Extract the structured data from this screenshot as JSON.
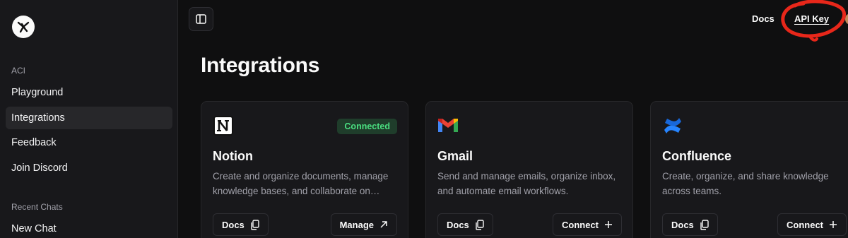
{
  "sidebar": {
    "logo_icon": "aci-logo-icon",
    "section_label": "ACI",
    "items": [
      {
        "label": "Playground",
        "active": false
      },
      {
        "label": "Integrations",
        "active": true
      },
      {
        "label": "Feedback",
        "active": false
      },
      {
        "label": "Join Discord",
        "active": false
      }
    ],
    "recent_label": "Recent Chats",
    "recent_items": [
      {
        "label": "New Chat"
      }
    ]
  },
  "header": {
    "toggle_icon": "sidebar-toggle-icon",
    "docs_label": "Docs",
    "api_key_label": "API Key",
    "annotation_color": "#e8271a"
  },
  "main": {
    "title": "Integrations",
    "cards": [
      {
        "name": "Notion",
        "icon": "notion-icon",
        "badge": "Connected",
        "description": "Create and organize documents, manage knowledge bases, and collaborate on…",
        "docs_label": "Docs",
        "action_label": "Manage",
        "action_icon": "arrow-up-right-icon"
      },
      {
        "name": "Gmail",
        "icon": "gmail-icon",
        "badge": "",
        "description": "Send and manage emails, organize inbox, and automate email workflows.",
        "docs_label": "Docs",
        "action_label": "Connect",
        "action_icon": "plus-icon"
      },
      {
        "name": "Confluence",
        "icon": "confluence-icon",
        "badge": "",
        "description": "Create, organize, and share knowledge across teams.",
        "docs_label": "Docs",
        "action_label": "Connect",
        "action_icon": "plus-icon"
      }
    ]
  },
  "colors": {
    "badge_bg": "#1f3d2b",
    "badge_text": "#4ade80",
    "sidebar_bg": "#18181b",
    "main_bg": "#0f0f10"
  }
}
